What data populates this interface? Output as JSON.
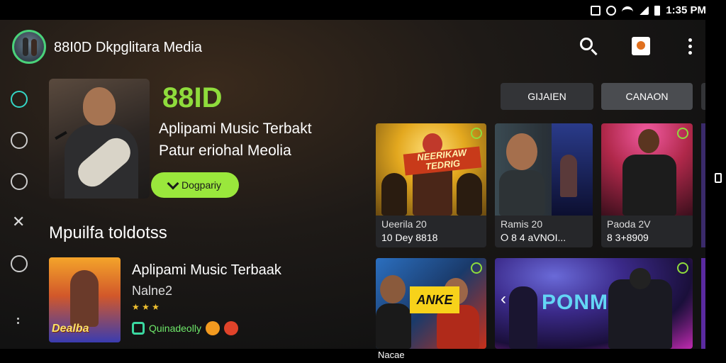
{
  "status_bar": {
    "time": "1:35 PM",
    "icons": [
      "nfc-icon",
      "alarm-icon",
      "wifi-icon",
      "signal-icon",
      "battery-icon"
    ]
  },
  "header": {
    "app_title": "88I0D Dkpglitara Media",
    "actions": [
      "search-icon",
      "cast-icon",
      "more-vert-icon"
    ]
  },
  "sidebar": {
    "items": [
      "home-icon",
      "explore-icon",
      "library-icon",
      "x-icon",
      "recycle-icon",
      "more-dots-icon"
    ]
  },
  "hero": {
    "code": "88ID",
    "line1": "Aplipami Music Terbakt",
    "line2": "Patur eriohal Meolia",
    "button_label": "Dogpariy"
  },
  "section": {
    "title": "Mpuilfa toldotss"
  },
  "list_item": {
    "title": "Aplipami Music Terbaak",
    "subtitle": "Nalne2",
    "rating": "★ ★ ★",
    "meta": "Quinadeolly",
    "thumb_caption": "Dealba"
  },
  "chips": [
    "GIJAIEN",
    "CANAON"
  ],
  "cards": [
    {
      "title": "Ueerila 20",
      "meta": "10 Dey 8818",
      "banner": "NEERIKAW TEDRIG"
    },
    {
      "title": "Ramis 20",
      "meta": "⭘ 8 4 aVNOI..."
    },
    {
      "title": "Paoda 2V",
      "meta": "8 3+8909"
    },
    {
      "banner": "ANKE"
    },
    {
      "big_text": "PONM"
    }
  ],
  "bottom_bar": {
    "label": "Nacae"
  },
  "colors": {
    "accent_green": "#8fdc3c",
    "button_green": "#9ae73c",
    "chip_dark": "#333437",
    "background": "#121212"
  }
}
